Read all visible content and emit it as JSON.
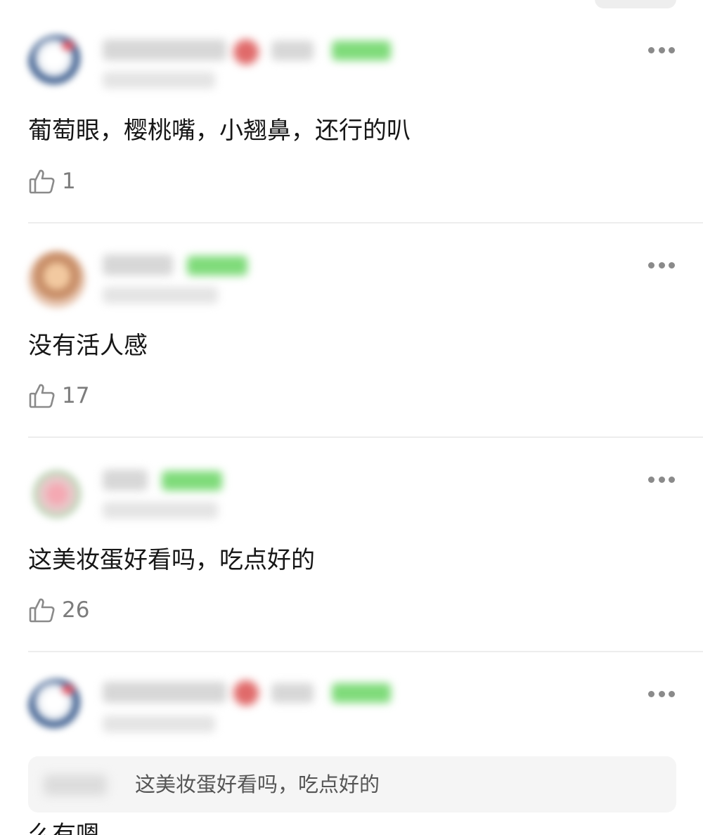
{
  "comments": [
    {
      "text": "葡萄眼，樱桃嘴，小翘鼻，还行的叭",
      "likes": "1"
    },
    {
      "text": "没有活人感",
      "likes": "17"
    },
    {
      "text": "这美妆蛋好看吗，吃点好的",
      "likes": "26"
    },
    {
      "quote": "这美妆蛋好看吗，吃点好的",
      "text": "么有嗯"
    }
  ],
  "icons": {
    "like": "thumbs-up-icon",
    "more": "more-dots-icon"
  },
  "colors": {
    "badge": "#7fdb7a",
    "text": "#161616",
    "muted": "#7c7c7c",
    "divider": "#ededed",
    "quote_bg": "#f5f5f5"
  }
}
